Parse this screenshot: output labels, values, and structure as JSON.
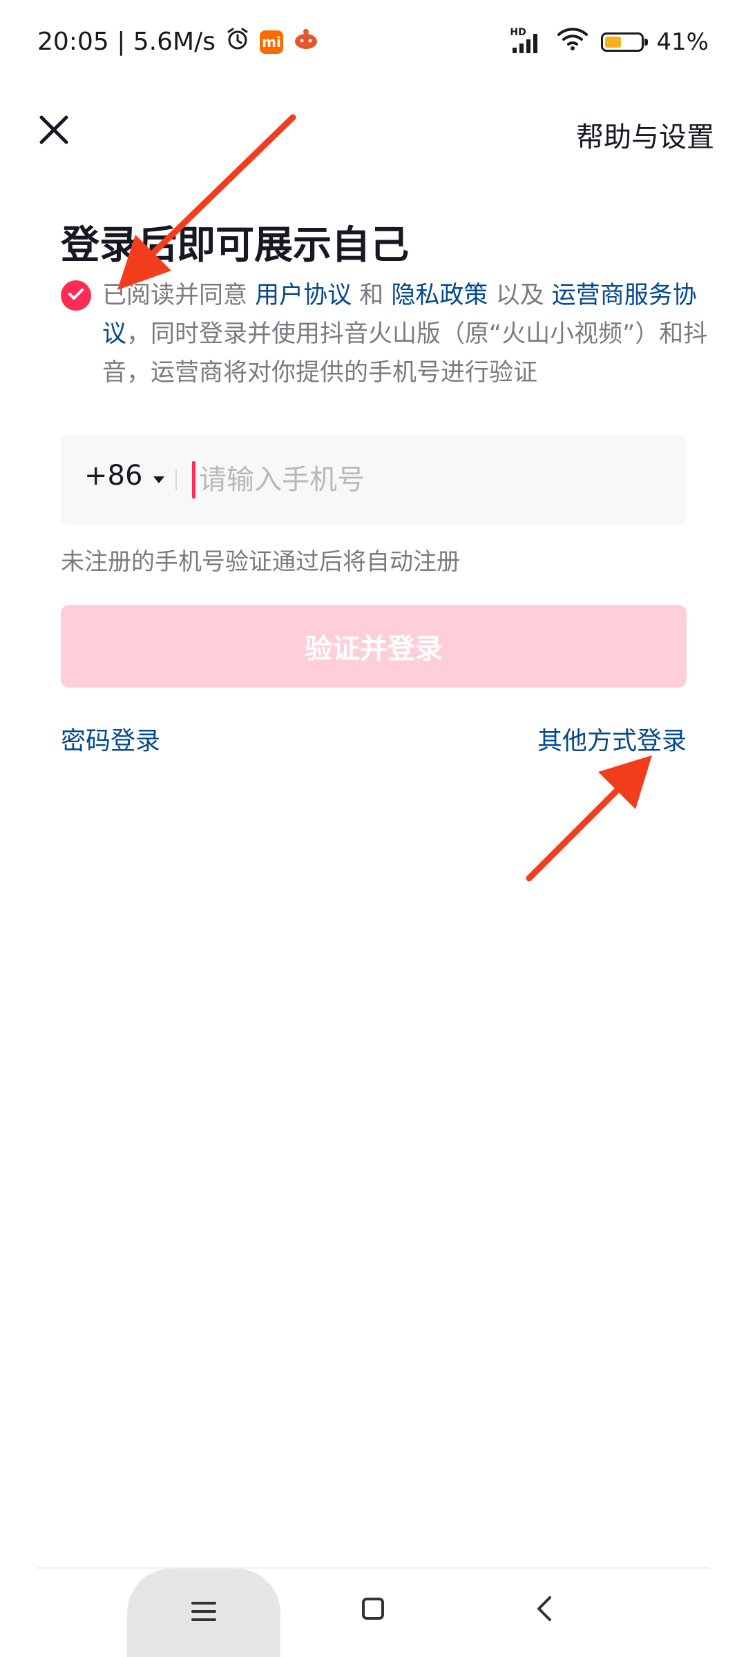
{
  "status_bar": {
    "time_speed": "20:05 | 5.6M/s",
    "mi_badge": "mi",
    "network_tag": "HD",
    "battery_text": "41%",
    "battery_level": 0.41
  },
  "header": {
    "help_label": "帮助与设置"
  },
  "main": {
    "title": "登录后即可展示自己",
    "agreement": {
      "checked": true,
      "part1": "已阅读并同意 ",
      "link_user": "用户协议",
      "part2": " 和 ",
      "link_privacy": "隐私政策",
      "part3": " 以及 ",
      "link_carrier": "运营商服务协议",
      "part4": "，同时登录并使用抖音火山版（原“火山小视频”）和抖音，运营商将对你提供的手机号进行验证"
    },
    "phone": {
      "country_code": "+86",
      "value": "",
      "placeholder": "请输入手机号"
    },
    "hint": "未注册的手机号验证通过后将自动注册",
    "submit_label": "验证并登录",
    "password_login": "密码登录",
    "other_login": "其他方式登录"
  },
  "colors": {
    "accent": "#fe2c55",
    "link": "#04498d",
    "disabled_button": "#fecfd9",
    "annotation_arrow": "#f23d1c"
  },
  "icons": {
    "close": "close-icon",
    "dropdown": "caret-down-icon",
    "check": "check-icon",
    "alarm": "alarm-clock-icon",
    "wifi": "wifi-icon",
    "signal": "signal-icon",
    "battery": "battery-icon",
    "nav_menu": "menu-icon",
    "nav_home": "home-square-icon",
    "nav_back": "back-chevron-icon"
  }
}
